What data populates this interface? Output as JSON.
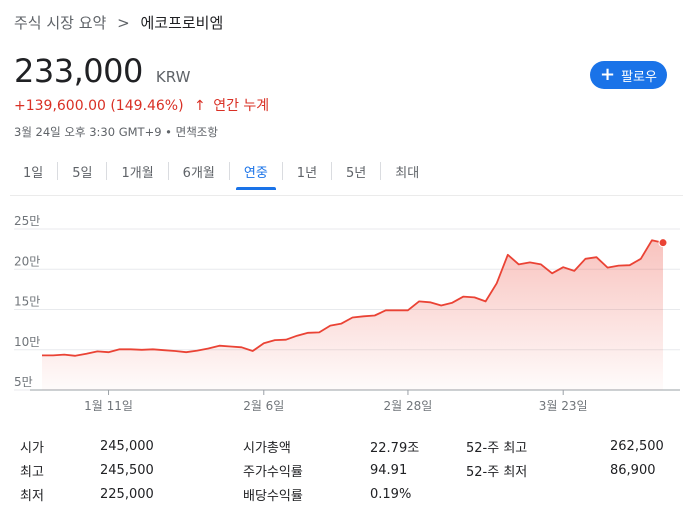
{
  "breadcrumb": {
    "section": "주식 시장 요약",
    "separator": ">",
    "company": "에코프로비엠"
  },
  "price": {
    "value": "233,000",
    "currency": "KRW"
  },
  "follow_button": {
    "label": "팔로우"
  },
  "change": {
    "absolute": "+139,600.00",
    "percent": "(149.46%)",
    "arrow": "↑",
    "period": "연간 누계"
  },
  "meta": "3월 24일 오후 3:30 GMT+9 • 면책조항",
  "tabs": [
    {
      "label": "1일"
    },
    {
      "label": "5일"
    },
    {
      "label": "1개월"
    },
    {
      "label": "6개월"
    },
    {
      "label": "연중",
      "active": true
    },
    {
      "label": "1년"
    },
    {
      "label": "5년"
    },
    {
      "label": "최대"
    }
  ],
  "colors": {
    "accent": "#1a73e8",
    "negative_positive": "#d93025",
    "line": "#ea4335"
  },
  "chart_data": {
    "type": "area",
    "ylim": [
      50000,
      250000
    ],
    "yticks": [
      "25만",
      "20만",
      "15만",
      "10만",
      "5만"
    ],
    "ytick_values": [
      250000,
      200000,
      150000,
      100000,
      50000
    ],
    "xtick_labels": [
      "1월 11일",
      "2월 6일",
      "2월 28일",
      "3월 23일"
    ],
    "xtick_indices": [
      6,
      20,
      33,
      47
    ],
    "series": [
      {
        "values": [
          93000,
          93000,
          94000,
          92500,
          95000,
          98000,
          97000,
          100500,
          100500,
          100000,
          100500,
          99500,
          98500,
          97000,
          99000,
          101500,
          105000,
          104000,
          103000,
          98500,
          108000,
          112000,
          112500,
          117500,
          121000,
          121500,
          130000,
          132500,
          140000,
          141500,
          142500,
          149000,
          149000,
          149000,
          160000,
          159000,
          155000,
          158500,
          166000,
          165000,
          160000,
          182500,
          218000,
          206000,
          208500,
          206000,
          195000,
          202500,
          198000,
          213000,
          215000,
          202000,
          204500,
          205000,
          213000,
          236000,
          233000
        ]
      }
    ],
    "grid": true,
    "last_point_marker": true
  },
  "stats": {
    "rows": [
      [
        {
          "label": "시가",
          "value": "245,000"
        },
        {
          "label": "시가총액",
          "value": "22.79조"
        },
        {
          "label": "52-주 최고",
          "value": "262,500"
        }
      ],
      [
        {
          "label": "최고",
          "value": "245,500"
        },
        {
          "label": "주가수익률",
          "value": "94.91"
        },
        {
          "label": "52-주 최저",
          "value": "86,900"
        }
      ],
      [
        {
          "label": "최저",
          "value": "225,000"
        },
        {
          "label": "배당수익률",
          "value": "0.19%"
        },
        {
          "label": "",
          "value": ""
        }
      ]
    ]
  }
}
